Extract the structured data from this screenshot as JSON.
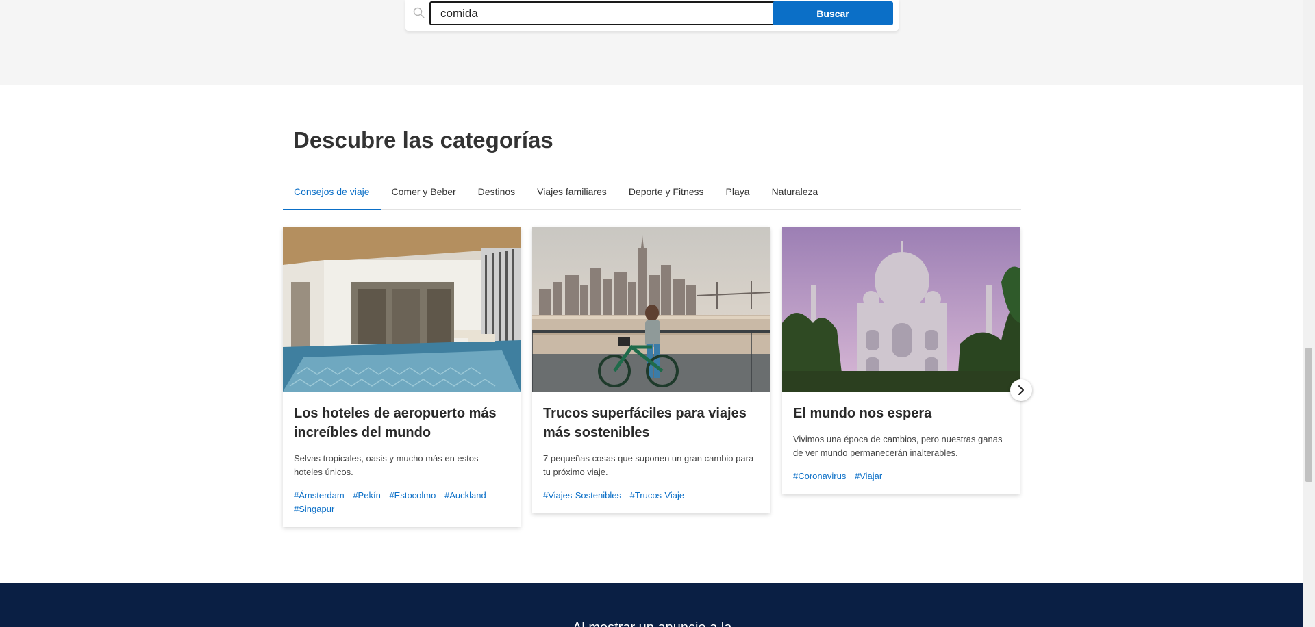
{
  "search": {
    "value": "comida",
    "button_label": "Buscar"
  },
  "section": {
    "title": "Descubre las categorías"
  },
  "tabs": [
    {
      "label": "Consejos de viaje",
      "active": true
    },
    {
      "label": "Comer y Beber",
      "active": false
    },
    {
      "label": "Destinos",
      "active": false
    },
    {
      "label": "Viajes familiares",
      "active": false
    },
    {
      "label": "Deporte y Fitness",
      "active": false
    },
    {
      "label": "Playa",
      "active": false
    },
    {
      "label": "Naturaleza",
      "active": false
    }
  ],
  "cards": [
    {
      "title": "Los hoteles de aeropuerto más increíbles del mundo",
      "description": "Selvas tropicales, oasis y mucho más en estos hoteles únicos.",
      "tags": [
        "#Ámsterdam",
        "#Pekín",
        "#Estocolmo",
        "#Auckland",
        "#Singapur"
      ]
    },
    {
      "title": "Trucos superfáciles para viajes más sostenibles",
      "description": "7 pequeñas cosas que suponen un gran cambio para tu próximo viaje.",
      "tags": [
        "#Viajes-Sostenibles",
        "#Trucos-Viaje"
      ]
    },
    {
      "title": "El mundo nos espera",
      "description": "Vivimos una época de cambios, pero nuestras ganas de ver mundo permanecerán inalterables.",
      "tags": [
        "#Coronavirus",
        "#Viajar"
      ]
    }
  ],
  "footer": {
    "text": "Al mostrar un anuncio a la"
  },
  "colors": {
    "accent": "#0b6fc7",
    "top_band": "#f5f5f5",
    "footer": "#0a1f44"
  },
  "icons": {
    "search": "search-icon",
    "next": "chevron-right-icon"
  }
}
